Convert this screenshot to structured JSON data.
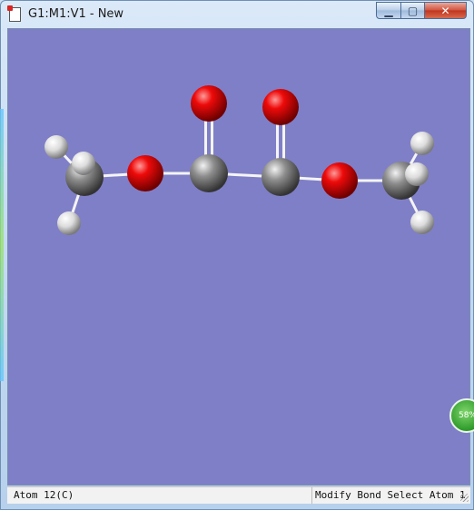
{
  "window": {
    "title": "G1:M1:V1 - New",
    "icon": "gaussview-document-icon",
    "controls": {
      "minimize": "minimize-icon",
      "maximize": "maximize-icon",
      "close": "close-icon"
    }
  },
  "colors": {
    "viewport_background": "#7f7fc8",
    "carbon": "#8a8a8a",
    "oxygen": "#e00000",
    "hydrogen": "#e6e6e6",
    "bond": "#f4f4f4"
  },
  "molecule": {
    "atoms": [
      {
        "element": "H"
      },
      {
        "element": "H"
      },
      {
        "element": "H"
      },
      {
        "element": "C"
      },
      {
        "element": "O"
      },
      {
        "element": "C"
      },
      {
        "element": "O"
      },
      {
        "element": "C"
      },
      {
        "element": "O"
      },
      {
        "element": "O"
      },
      {
        "element": "H"
      },
      {
        "element": "C"
      },
      {
        "element": "H"
      },
      {
        "element": "H"
      }
    ]
  },
  "status": {
    "left": "Atom 12(C)",
    "right": "Modify Bond Select Atom 1"
  },
  "progress_widget": {
    "label": "58%",
    "value": 58
  }
}
